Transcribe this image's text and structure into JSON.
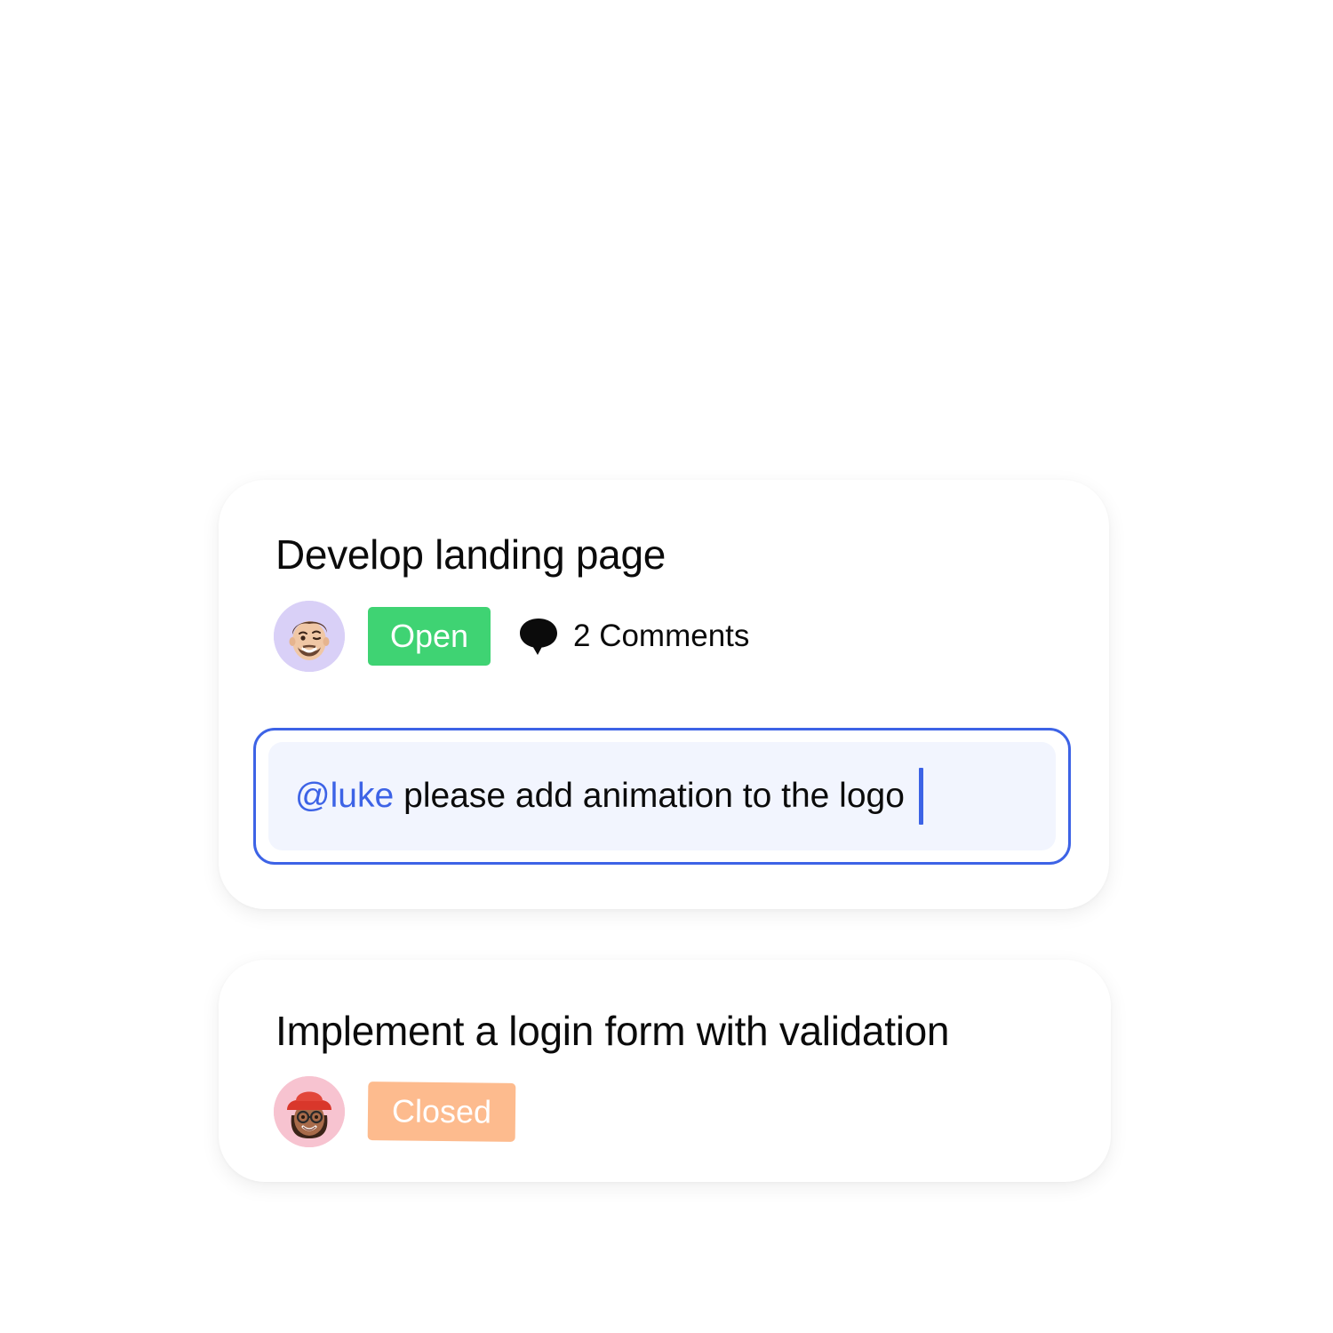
{
  "tasks": [
    {
      "title": "Develop landing page",
      "assignee_avatar": "man-memoji-avatar",
      "status": "Open",
      "comments_label": "2 Comments",
      "comments_icon": "speech-bubble-icon",
      "comment_input": {
        "mention": "@luke",
        "text": "please add animation to the logo"
      }
    },
    {
      "title": "Implement a login form with validation",
      "assignee_avatar": "woman-memoji-avatar",
      "status": "Closed"
    }
  ],
  "colors": {
    "open": "#3fd373",
    "closed": "#fdbb8e",
    "accent": "#3d63e6",
    "input_background": "#f2f5fe"
  }
}
